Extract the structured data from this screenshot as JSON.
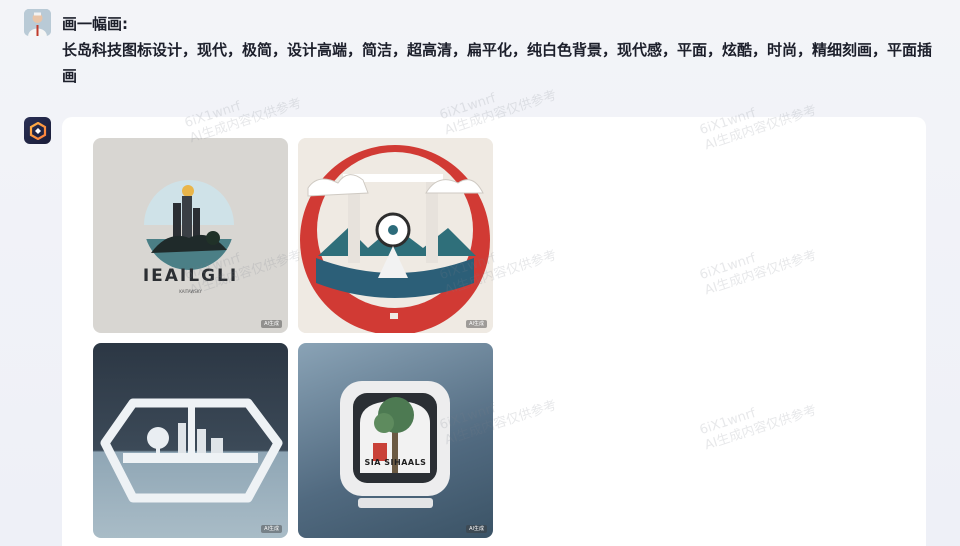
{
  "user": {
    "title": "画一幅画:",
    "prompt": "长岛科技图标设计，现代，极简，设计高端，简洁，超高清，扁平化，纯白色背景，现代感，平面，炫酷，时尚，精细刻画，平面插画"
  },
  "watermark": {
    "line1": "6iX1wnrf",
    "line2": "AI生成内容仅供参考"
  },
  "images": [
    {
      "caption": "IEAILGLI",
      "subcaption": "KAITAWSKY",
      "badge": "AI生成"
    },
    {
      "badge": "AI生成"
    },
    {
      "badge": "AI生成"
    },
    {
      "caption": "SIA SIHAALS",
      "badge": "AI生成"
    }
  ]
}
